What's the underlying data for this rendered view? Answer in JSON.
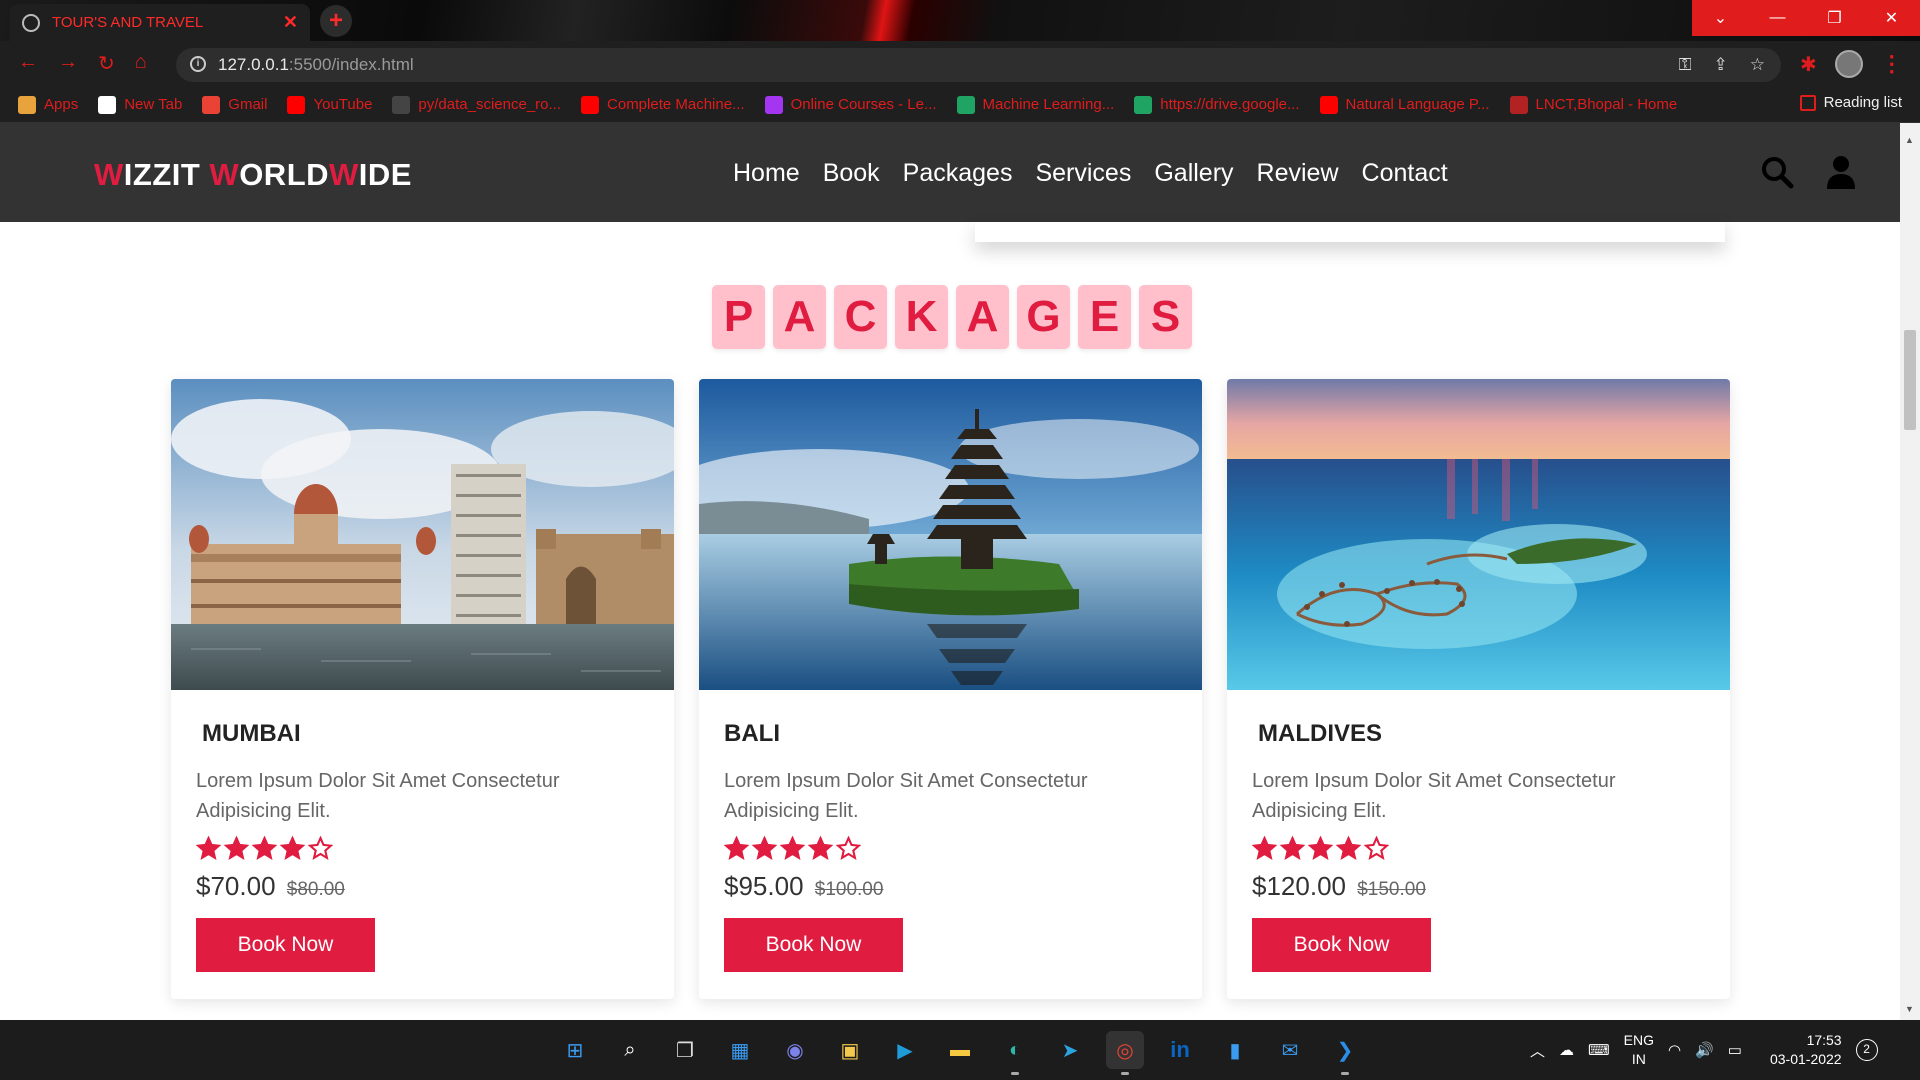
{
  "browser": {
    "tab_title": "TOUR'S AND TRAVEL",
    "url_host": "127.0.0.1",
    "url_path": ":5500/index.html",
    "bookmarks": [
      {
        "label": "Apps",
        "icon": "apps-grid-icon",
        "color": "#e8a33d"
      },
      {
        "label": "New Tab",
        "icon": "google-icon",
        "color": "#ffffff"
      },
      {
        "label": "Gmail",
        "icon": "gmail-icon",
        "color": "#ea4335"
      },
      {
        "label": "YouTube",
        "icon": "youtube-icon",
        "color": "#ff0000"
      },
      {
        "label": "py/data_science_ro...",
        "icon": "github-icon",
        "color": "#444444"
      },
      {
        "label": "Complete Machine...",
        "icon": "youtube-icon",
        "color": "#ff0000"
      },
      {
        "label": "Online Courses - Le...",
        "icon": "udemy-icon",
        "color": "#a435f0"
      },
      {
        "label": "Machine Learning...",
        "icon": "drive-icon",
        "color": "#1fa463"
      },
      {
        "label": "https://drive.google...",
        "icon": "drive-icon",
        "color": "#1fa463"
      },
      {
        "label": "Natural Language P...",
        "icon": "youtube-icon",
        "color": "#ff0000"
      },
      {
        "label": "LNCT,Bhopal - Home",
        "icon": "college-icon",
        "color": "#b22222"
      }
    ],
    "reading_list": "Reading list"
  },
  "site": {
    "logo_parts": [
      {
        "text": "W",
        "red": true
      },
      {
        "text": "IZZIT ",
        "red": false
      },
      {
        "text": "W",
        "red": true
      },
      {
        "text": "ORLD",
        "red": false
      },
      {
        "text": "W",
        "red": true
      },
      {
        "text": "IDE",
        "red": false
      }
    ],
    "nav": [
      "Home",
      "Book",
      "Packages",
      "Services",
      "Gallery",
      "Review",
      "Contact"
    ],
    "accent": "#e01c40",
    "heading_letters": [
      "P",
      "A",
      "C",
      "K",
      "A",
      "G",
      "E",
      "S"
    ],
    "packages": [
      {
        "title": "MUMBAI",
        "desc": "Lorem Ipsum Dolor Sit Amet Consectetur Adipisicing Elit.",
        "rating": 4,
        "price": "$70.00",
        "old_price": "$80.00",
        "button": "Book Now"
      },
      {
        "title": "BALI",
        "desc": "Lorem Ipsum Dolor Sit Amet Consectetur Adipisicing Elit.",
        "rating": 4,
        "price": "$95.00",
        "old_price": "$100.00",
        "button": "Book Now"
      },
      {
        "title": "MALDIVES",
        "desc": "Lorem Ipsum Dolor Sit Amet Consectetur Adipisicing Elit.",
        "rating": 4,
        "price": "$120.00",
        "old_price": "$150.00",
        "button": "Book Now"
      }
    ]
  },
  "taskbar": {
    "apps": [
      "windows-start-icon",
      "search-icon",
      "task-view-icon",
      "widgets-icon",
      "teams-chat-icon",
      "store-icon",
      "prime-video-icon",
      "file-explorer-icon",
      "edge-icon",
      "telegram-icon",
      "chrome-icon",
      "linkedin-icon",
      "phone-icon",
      "mail-icon",
      "vscode-icon"
    ],
    "lang_top": "ENG",
    "lang_bottom": "IN",
    "time": "17:53",
    "date": "03-01-2022",
    "notifications": "2"
  }
}
